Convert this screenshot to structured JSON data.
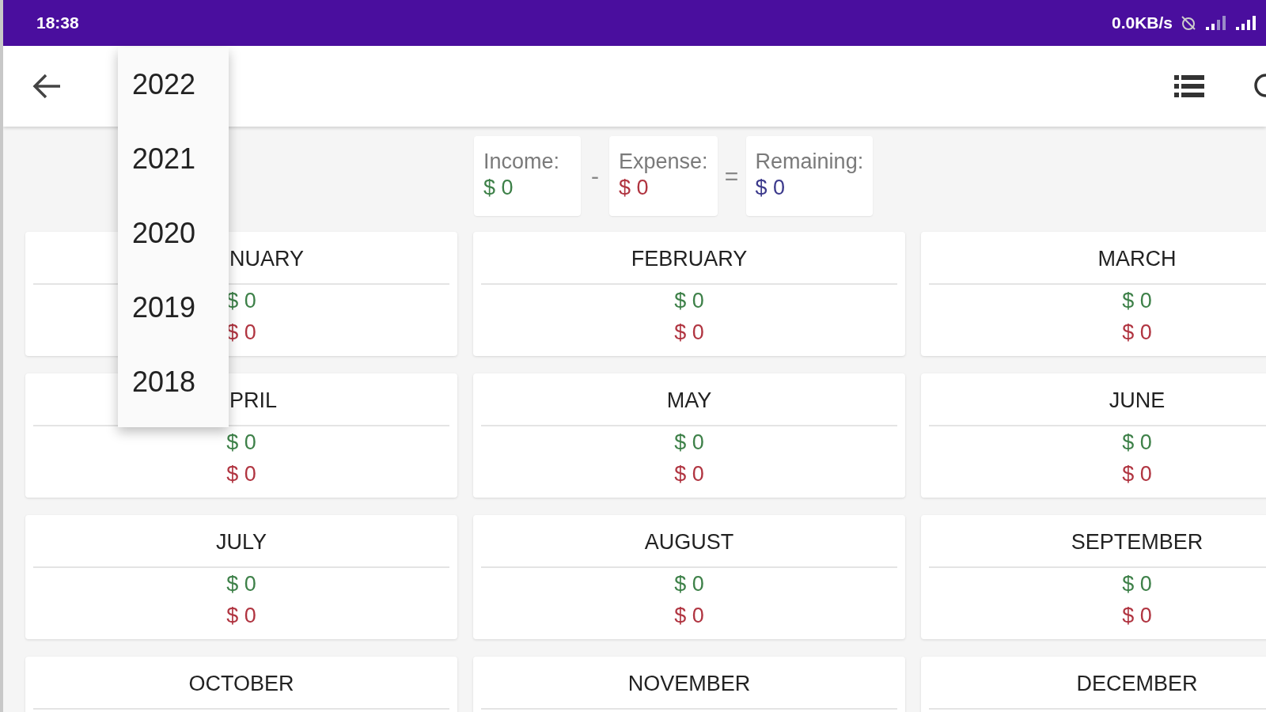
{
  "status_bar": {
    "time": "18:38",
    "net_speed": "0.0KB/s"
  },
  "summary": [
    {
      "kind": "income",
      "label": "Income:",
      "value": "$ 0"
    },
    {
      "kind": "operator",
      "text": "-"
    },
    {
      "kind": "expense",
      "label": "Expense:",
      "value": "$ 0"
    },
    {
      "kind": "operator",
      "text": "="
    },
    {
      "kind": "remaining",
      "label": "Remaining:",
      "value": "$ 0"
    }
  ],
  "months": [
    {
      "title": "NUARY",
      "income": "$ 0",
      "expense": "$ 0"
    },
    {
      "title": "FEBRUARY",
      "income": "$ 0",
      "expense": "$ 0"
    },
    {
      "title": "MARCH",
      "income": "$ 0",
      "expense": "$ 0"
    },
    {
      "title": "PRIL",
      "income": "$ 0",
      "expense": "$ 0"
    },
    {
      "title": "MAY",
      "income": "$ 0",
      "expense": "$ 0"
    },
    {
      "title": "JUNE",
      "income": "$ 0",
      "expense": "$ 0"
    },
    {
      "title": "JULY",
      "income": "$ 0",
      "expense": "$ 0"
    },
    {
      "title": "AUGUST",
      "income": "$ 0",
      "expense": "$ 0"
    },
    {
      "title": "SEPTEMBER",
      "income": "$ 0",
      "expense": "$ 0"
    },
    {
      "title": "OCTOBER"
    },
    {
      "title": "NOVEMBER"
    },
    {
      "title": "DECEMBER"
    }
  ],
  "year_menu": {
    "items": [
      {
        "label": "2022"
      },
      {
        "label": "2021"
      },
      {
        "label": "2020"
      },
      {
        "label": "2019"
      },
      {
        "label": "2018"
      }
    ]
  }
}
